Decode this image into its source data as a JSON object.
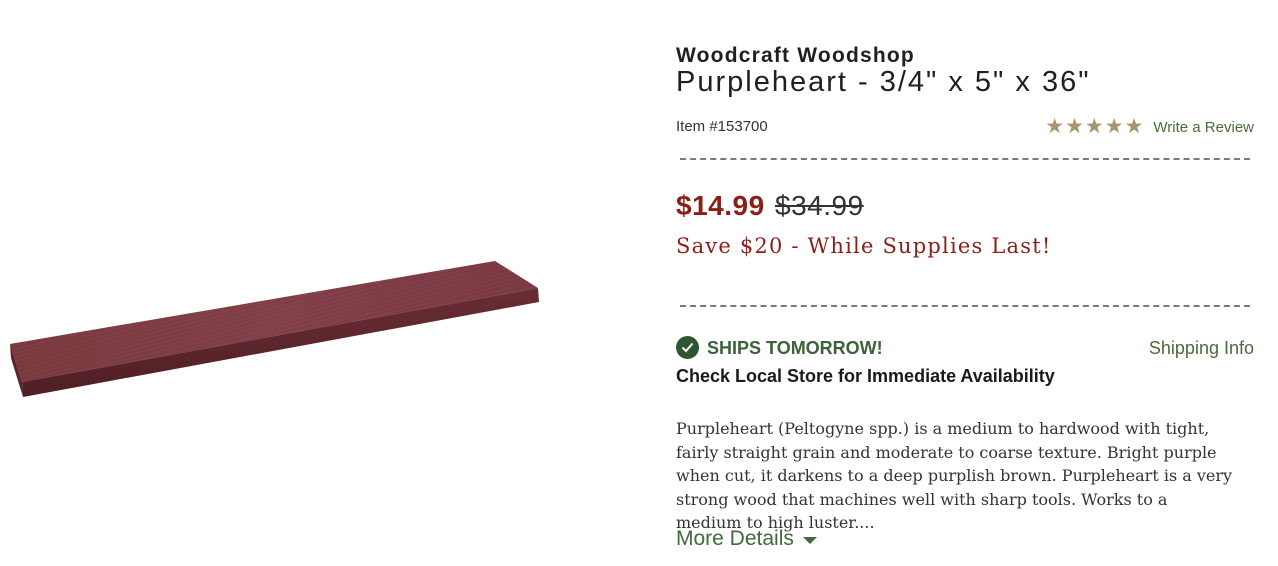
{
  "product": {
    "brand": "Woodcraft Woodshop",
    "title": "Purpleheart - 3/4\" x 5\" x 36\"",
    "item_number": "Item #153700",
    "image_alt": "purpleheart-board"
  },
  "rating": {
    "stars": 5,
    "review_link": "Write a Review",
    "star_color": "#a8956b"
  },
  "pricing": {
    "sale_price": "$14.99",
    "original_price": "$34.99",
    "savings_message": "Save $20 - While Supplies Last!",
    "price_color": "#8b1e17"
  },
  "shipping": {
    "status": "SHIPS TOMORROW!",
    "info_link": "Shipping Info",
    "local_store": "Check Local Store for Immediate Availability",
    "status_icon": "check-circle-icon",
    "accent_color": "#2f5530"
  },
  "description": {
    "text": "Purpleheart (Peltogyne spp.) is a medium to hardwood with tight, fairly straight grain and moderate to coarse texture. Bright purple when cut, it darkens to a deep purplish brown. Purpleheart is a very strong wood that machines well with sharp tools. Works to a medium to high luster....",
    "more_details": "More Details",
    "more_icon": "caret-down-icon"
  }
}
